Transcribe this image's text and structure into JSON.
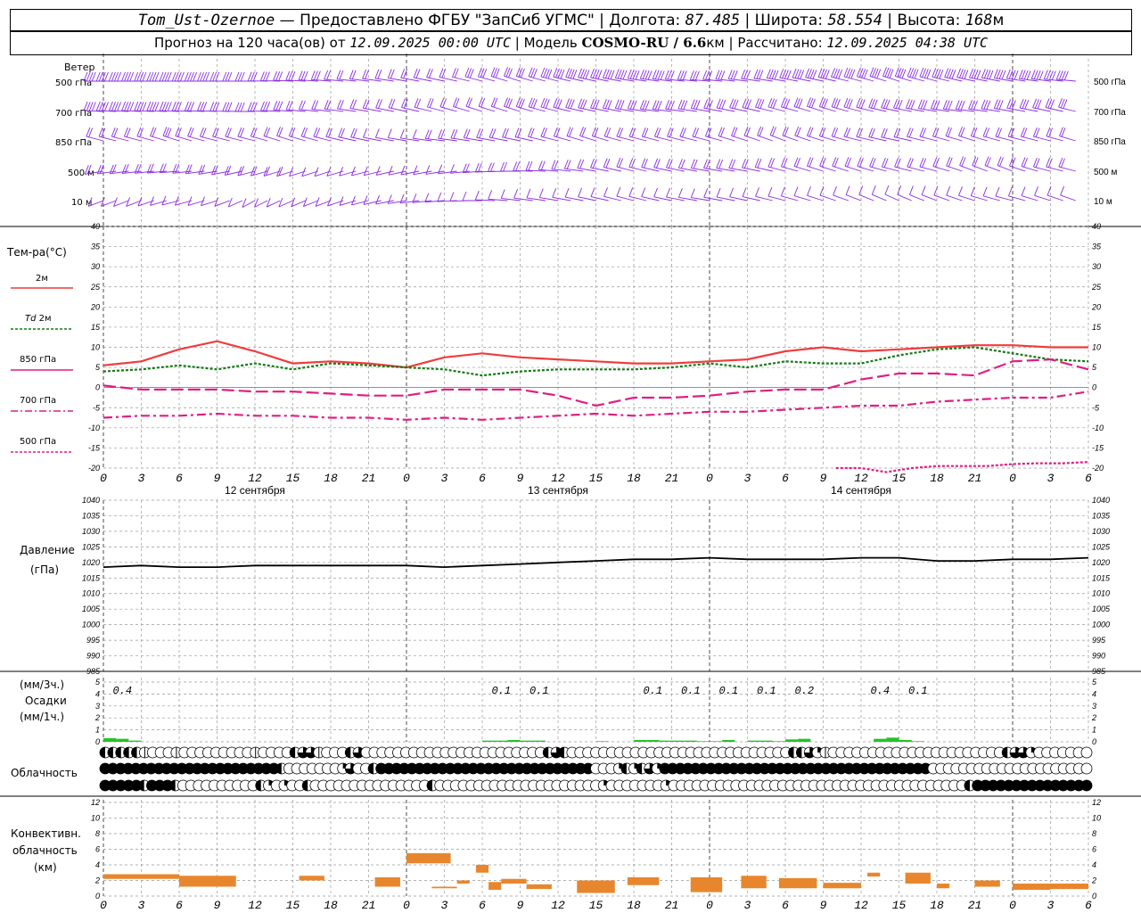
{
  "header": {
    "station": "Tom_Ust-Ozernoe",
    "provider": " — Предоставлено ФГБУ \"ЗапСиб УГМС\" | Долгота: ",
    "lon": "87.485",
    "lat_label": " | Широта: ",
    "lat": "58.554",
    "alt_label": " | Высота: ",
    "alt": "168",
    "alt_unit": "м",
    "forecast_label": "Прогноз на 120 часа(ов) от ",
    "start_time": "12.09.2025 00:00 UTC",
    "model_label": " | Модель ",
    "model": "COSMO-RU / 6.6",
    "model_unit": "км",
    "calc_label": " | Рассчитано: ",
    "calc_time": "12.09.2025 04:38 UTC"
  },
  "labels": {
    "wind": "Ветер",
    "wind_levels": [
      "500 гПа",
      "700 гПа",
      "850 гПа",
      "500 м",
      "10 м"
    ],
    "temp_title": "Тем-ра(°С)",
    "temp_2m": "2м",
    "td_prefix": "Td",
    "td_2m": "2м",
    "t850": "850 гПа",
    "t700": "700 гПа",
    "t500": "500 гПа",
    "pressure_title": "Давление",
    "pressure_unit": "(гПа)",
    "precip_unit3": "(мм/3ч.)",
    "precip_title": "Осадки",
    "precip_unit1": "(мм/1ч.)",
    "cloud_title": "Облачность",
    "conv_title1": "Конвективн.",
    "conv_title2": "облачность",
    "conv_unit": "(км)"
  },
  "colors": {
    "t2m": "#f03c3c",
    "td2m": "#137a13",
    "t850": "#e01e82",
    "t700": "#e01e82",
    "t500": "#e01e82",
    "wind": "#8a2be2",
    "pressure": "#000000",
    "precip": "#22c422",
    "conv": "#e8862e",
    "grid": "#999999",
    "zero_line": "#3c3cff"
  },
  "chart_data": {
    "type": "line",
    "time_hours_utc": [
      0,
      3,
      6,
      9,
      12,
      15,
      18,
      21,
      0,
      3,
      6,
      9,
      12,
      15,
      18,
      21,
      0,
      3,
      6,
      9,
      12,
      15,
      18,
      21,
      0,
      3,
      6
    ],
    "day_labels": [
      "12 сентября",
      "13 сентября",
      "14 сентября"
    ],
    "temperature": {
      "ylim": [
        -20,
        40
      ],
      "ticks": [
        -20,
        -15,
        -10,
        -5,
        0,
        5,
        10,
        15,
        20,
        25,
        30,
        35,
        40
      ],
      "x_hours": [
        0,
        3,
        6,
        9,
        12,
        15,
        18,
        21,
        24,
        27,
        30,
        33,
        36,
        39,
        42,
        45,
        48,
        51,
        54,
        57,
        60,
        63,
        66,
        69,
        72,
        75,
        78
      ],
      "series": [
        {
          "name": "2м",
          "values": [
            5.5,
            6.5,
            9.5,
            11.5,
            9,
            6,
            6.5,
            6,
            5,
            7.5,
            8.5,
            7.5,
            7,
            6.5,
            6,
            6,
            6.5,
            7,
            9,
            10,
            9,
            9.5,
            10,
            10.5,
            10.5,
            10,
            10
          ]
        },
        {
          "name": "Td 2м",
          "values": [
            4,
            4.5,
            5.5,
            4.5,
            6,
            4.5,
            6,
            5.5,
            5,
            4.5,
            3,
            4,
            4.5,
            4.5,
            4.5,
            5,
            6,
            5,
            6.5,
            6,
            6,
            8,
            9.5,
            10,
            8.5,
            7,
            6.5
          ]
        },
        {
          "name": "850 гПа",
          "values": [
            0.5,
            -0.5,
            -0.5,
            -0.5,
            -1,
            -1,
            -1.5,
            -2,
            -2,
            -0.5,
            -0.5,
            -0.5,
            -2,
            -4.5,
            -2.5,
            -2.5,
            -2,
            -1,
            -0.5,
            -0.5,
            2,
            3.5,
            3.5,
            3,
            6.5,
            7,
            4.5
          ]
        },
        {
          "name": "700 гПа",
          "values": [
            -7.5,
            -7,
            -7,
            -6.5,
            -7,
            -7,
            -7.5,
            -7.5,
            -8,
            -7.5,
            -8,
            -7.5,
            -7,
            -6.5,
            -7,
            -6.5,
            -6,
            -6,
            -5.5,
            -5,
            -4.5,
            -4.5,
            -3.5,
            -3,
            -2.5,
            -2.5,
            -1
          ]
        },
        {
          "name": "500 гПа",
          "x_hours": [
            58,
            60,
            62,
            64,
            66,
            68,
            70,
            72,
            74,
            76,
            78
          ],
          "values": [
            -20,
            -20,
            -21,
            -20,
            -19.5,
            -19.5,
            -19.5,
            -19,
            -18.8,
            -18.8,
            -18.5
          ]
        }
      ]
    },
    "pressure": {
      "ylim": [
        985,
        1040
      ],
      "ticks": [
        985,
        990,
        995,
        1000,
        1005,
        1010,
        1015,
        1020,
        1025,
        1030,
        1035,
        1040
      ],
      "x_hours": [
        0,
        3,
        6,
        9,
        12,
        15,
        18,
        21,
        24,
        27,
        30,
        33,
        36,
        39,
        42,
        45,
        48,
        51,
        54,
        57,
        60,
        63,
        66,
        69,
        72,
        75,
        78
      ],
      "values": [
        1018.5,
        1019,
        1018.5,
        1018.5,
        1019,
        1019,
        1019,
        1019,
        1019,
        1018.5,
        1019,
        1019.5,
        1020,
        1020.5,
        1021,
        1021,
        1021.5,
        1021,
        1021,
        1021,
        1021.5,
        1021.5,
        1020.5,
        1020.5,
        1021,
        1021,
        1021.5
      ]
    },
    "precipitation": {
      "ylim": [
        0,
        5
      ],
      "ticks": [
        0,
        1,
        2,
        3,
        4,
        5
      ],
      "totals_3h": [
        {
          "hour": 1.5,
          "label": "0.4"
        },
        {
          "hour": 31.5,
          "label": "0.1"
        },
        {
          "hour": 34.5,
          "label": "0.1"
        },
        {
          "hour": 43.5,
          "label": "0.1"
        },
        {
          "hour": 46.5,
          "label": "0.1"
        },
        {
          "hour": 49.5,
          "label": "0.1"
        },
        {
          "hour": 52.5,
          "label": "0.1"
        },
        {
          "hour": 55.5,
          "label": "0.2"
        },
        {
          "hour": 61.5,
          "label": "0.4"
        },
        {
          "hour": 64.5,
          "label": "0.1"
        }
      ],
      "hourly": [
        {
          "hour": 0,
          "value": 0.3
        },
        {
          "hour": 1,
          "value": 0.25
        },
        {
          "hour": 2,
          "value": 0.1
        },
        {
          "hour": 30,
          "value": 0.1
        },
        {
          "hour": 31,
          "value": 0.1
        },
        {
          "hour": 32,
          "value": 0.15
        },
        {
          "hour": 33,
          "value": 0.1
        },
        {
          "hour": 34,
          "value": 0.1
        },
        {
          "hour": 39,
          "value": 0.05
        },
        {
          "hour": 42,
          "value": 0.15
        },
        {
          "hour": 43,
          "value": 0.15
        },
        {
          "hour": 44,
          "value": 0.1
        },
        {
          "hour": 45,
          "value": 0.1
        },
        {
          "hour": 46,
          "value": 0.1
        },
        {
          "hour": 47,
          "value": 0.05
        },
        {
          "hour": 48,
          "value": 0.05
        },
        {
          "hour": 49,
          "value": 0.15
        },
        {
          "hour": 51,
          "value": 0.1
        },
        {
          "hour": 52,
          "value": 0.1
        },
        {
          "hour": 53,
          "value": 0.05
        },
        {
          "hour": 54,
          "value": 0.2
        },
        {
          "hour": 55,
          "value": 0.25
        },
        {
          "hour": 61,
          "value": 0.25
        },
        {
          "hour": 62,
          "value": 0.35
        },
        {
          "hour": 63,
          "value": 0.15
        },
        {
          "hour": 64,
          "value": 0.05
        }
      ]
    },
    "cloud_rows": [
      "HHHHHCOOOCOOOOOOOOOCOOOOHVVCOOOHVOOOOOOOOOOOOOOOOOOOOOOOHVHOOOOOOOOOOOOOOOOOOOOOOOOOOOOHHVQCOOOOOOOOOOOOOOOOOOOOOOHVVQOOOOOOO",
      "FFFFFFFFFFFFFFFFFFFFFFFHOOOOOOOQVOOHFFFFFFFFFFFFFFFFFFFFFFFFFFFFOOOQHQHVQFFFFFFFFFFFFFFFFFFFFFFFFFFFFFFFFFFFOOOOOOOOOOOOOOOOOOOOO",
      "FFFFFHFFFHOOOOOOOOOOHQOQOOHOOOOOOOOOOOOOOOHOOOOOOOOOOOOOOOOOOOOOQOOOOOOOQOOOOOOOOOOOOOOOOOOOOOOOOOOOOOOOOOOOOOOHFFFFFFFFFFFFFFF"
    ],
    "convective": {
      "ylim": [
        0,
        12
      ],
      "ticks": [
        0,
        2,
        4,
        6,
        8,
        10,
        12
      ],
      "bars": [
        {
          "from": 0,
          "to": 6,
          "bottom": 2.2,
          "top": 2.8
        },
        {
          "from": 6,
          "to": 10.5,
          "bottom": 1.2,
          "top": 2.6
        },
        {
          "from": 15.5,
          "to": 17.5,
          "bottom": 2.0,
          "top": 2.6
        },
        {
          "from": 21.5,
          "to": 23.5,
          "bottom": 1.2,
          "top": 2.4
        },
        {
          "from": 24,
          "to": 27.5,
          "bottom": 4.2,
          "top": 5.5
        },
        {
          "from": 26,
          "to": 28,
          "bottom": 1.0,
          "top": 1.2
        },
        {
          "from": 28,
          "to": 29,
          "bottom": 1.6,
          "top": 2.0
        },
        {
          "from": 29.5,
          "to": 30.5,
          "bottom": 3.0,
          "top": 4.0
        },
        {
          "from": 30.5,
          "to": 31.5,
          "bottom": 0.8,
          "top": 1.8
        },
        {
          "from": 31.5,
          "to": 33.5,
          "bottom": 1.6,
          "top": 2.2
        },
        {
          "from": 33.5,
          "to": 35.5,
          "bottom": 0.9,
          "top": 1.5
        },
        {
          "from": 37.5,
          "to": 40.5,
          "bottom": 0.4,
          "top": 2.0
        },
        {
          "from": 41.5,
          "to": 44,
          "bottom": 1.4,
          "top": 2.4
        },
        {
          "from": 46.5,
          "to": 49,
          "bottom": 0.5,
          "top": 2.4
        },
        {
          "from": 50.5,
          "to": 52.5,
          "bottom": 1.0,
          "top": 2.6
        },
        {
          "from": 53.5,
          "to": 56.5,
          "bottom": 1.0,
          "top": 2.3
        },
        {
          "from": 57,
          "to": 60,
          "bottom": 1.0,
          "top": 1.7
        },
        {
          "from": 60.5,
          "to": 61.5,
          "bottom": 2.5,
          "top": 3.0
        },
        {
          "from": 63.5,
          "to": 65.5,
          "bottom": 1.6,
          "top": 3.0
        },
        {
          "from": 66,
          "to": 67,
          "bottom": 1.0,
          "top": 1.6
        },
        {
          "from": 69,
          "to": 71,
          "bottom": 1.2,
          "top": 2.0
        },
        {
          "from": 72,
          "to": 75,
          "bottom": 0.8,
          "top": 1.6
        },
        {
          "from": 75,
          "to": 78,
          "bottom": 0.9,
          "top": 1.6
        }
      ]
    },
    "wind_barbs": {
      "levels": [
        "500 гПа",
        "700 гПа",
        "850 гПа",
        "500 м",
        "10 м"
      ],
      "direction_deg": [
        [
          270,
          270,
          270,
          270,
          270,
          275,
          280,
          285,
          290,
          295,
          300,
          305,
          300,
          295,
          290,
          285,
          280,
          285,
          290,
          295,
          300,
          305,
          300,
          295,
          290,
          285,
          280
        ],
        [
          275,
          275,
          275,
          275,
          270,
          280,
          285,
          290,
          295,
          300,
          305,
          305,
          300,
          295,
          290,
          285,
          290,
          295,
          300,
          305,
          300,
          295,
          290,
          285,
          290,
          295,
          300
        ],
        [
          300,
          300,
          305,
          300,
          300,
          305,
          300,
          295,
          290,
          285,
          290,
          295,
          300,
          305,
          300,
          300,
          300,
          305,
          310,
          305,
          300,
          295,
          300,
          305,
          300,
          300,
          305
        ],
        [
          250,
          255,
          260,
          250,
          240,
          235,
          235,
          240,
          245,
          250,
          260,
          270,
          280,
          290,
          300,
          295,
          290,
          290,
          300,
          305,
          305,
          300,
          300,
          310,
          310,
          300,
          300
        ],
        [
          230,
          230,
          240,
          235,
          220,
          225,
          230,
          240,
          250,
          260,
          270,
          285,
          290,
          295,
          300,
          295,
          290,
          295,
          300,
          305,
          310,
          315,
          310,
          305,
          300,
          305,
          310
        ]
      ],
      "speed_kt": [
        [
          40,
          40,
          40,
          35,
          30,
          30,
          25,
          20,
          20,
          20,
          25,
          30,
          35,
          40,
          40,
          35,
          30,
          30,
          35,
          40,
          40,
          40,
          35,
          35,
          40,
          40,
          45
        ],
        [
          35,
          35,
          35,
          30,
          25,
          25,
          20,
          20,
          15,
          20,
          20,
          25,
          25,
          30,
          30,
          30,
          25,
          25,
          30,
          30,
          30,
          30,
          25,
          25,
          30,
          30,
          30
        ],
        [
          20,
          20,
          25,
          20,
          15,
          15,
          15,
          15,
          10,
          15,
          15,
          20,
          20,
          20,
          20,
          20,
          20,
          20,
          20,
          20,
          15,
          15,
          15,
          15,
          20,
          20,
          20
        ],
        [
          15,
          20,
          20,
          15,
          15,
          15,
          10,
          10,
          10,
          10,
          15,
          15,
          15,
          15,
          15,
          15,
          15,
          15,
          15,
          15,
          15,
          15,
          15,
          15,
          15,
          15,
          15
        ],
        [
          10,
          10,
          10,
          10,
          5,
          5,
          5,
          10,
          10,
          10,
          10,
          10,
          10,
          10,
          10,
          10,
          10,
          10,
          10,
          10,
          10,
          10,
          10,
          10,
          10,
          10,
          10
        ]
      ]
    }
  }
}
